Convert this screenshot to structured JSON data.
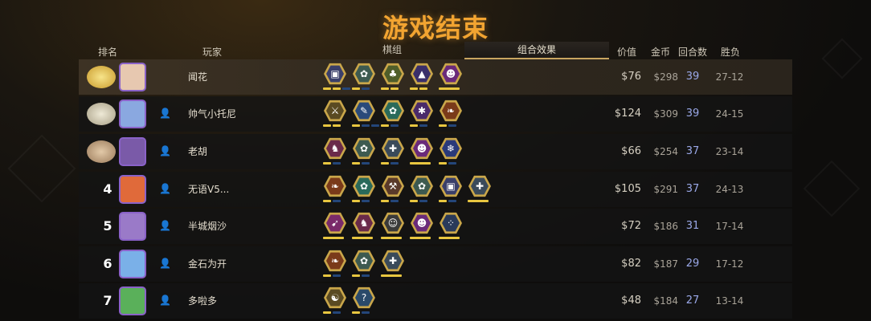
{
  "title": "游戏结束",
  "headers": {
    "rank": "排名",
    "player": "玩家",
    "board": "棋组",
    "combo": "组合效果",
    "price": "价值",
    "gold": "金币",
    "rounds": "回合数",
    "record": "胜负"
  },
  "players": [
    {
      "rank": "",
      "name": "闻花",
      "price": "$76",
      "gold": "$298",
      "rounds": "39",
      "record": "27-12",
      "medal": "gold",
      "avatar_color": "#e7c8b0",
      "synergies": [
        {
          "icon": "armor-icon",
          "color": "#3a3f6a",
          "symbol": "▣",
          "pips": [
            "#e8c640",
            "#e8c640",
            "#24467a"
          ]
        },
        {
          "icon": "beast-icon",
          "color": "#3d5a50",
          "symbol": "✿",
          "pips": [
            "#e8c640",
            "#24467a"
          ]
        },
        {
          "icon": "element-icon",
          "color": "#4f5e2a",
          "symbol": "♣",
          "pips": [
            "#e8c640",
            "#e8c640"
          ]
        },
        {
          "icon": "mage-icon",
          "color": "#3a2f6a",
          "symbol": "▲",
          "pips": [
            "#e8c640",
            "#e8c640"
          ]
        },
        {
          "icon": "demon-icon",
          "color": "#6a2a7a",
          "symbol": "☻",
          "pips": [
            "#e8c640"
          ]
        }
      ]
    },
    {
      "rank": "",
      "name": "帅气小托尼",
      "price": "$124",
      "gold": "$309",
      "rounds": "39",
      "record": "24-15",
      "medal": "silver",
      "avatar_color": "#8aa8e0",
      "synergies": [
        {
          "icon": "warrior-icon",
          "color": "#5a4a22",
          "symbol": "⚔",
          "pips": [
            "#e8c640",
            "#e8c640"
          ]
        },
        {
          "icon": "feather-icon",
          "color": "#2a4a7a",
          "symbol": "✎",
          "pips": [
            "#e8c640",
            "#24467a",
            "#24467a"
          ]
        },
        {
          "icon": "paw-icon",
          "color": "#2a6a5a",
          "symbol": "✿",
          "pips": [
            "#e8c640",
            "#24467a"
          ]
        },
        {
          "icon": "fish-icon",
          "color": "#4a2a6a",
          "symbol": "✱",
          "pips": [
            "#e8c640",
            "#24467a"
          ]
        },
        {
          "icon": "leaf-icon",
          "color": "#7a3a1a",
          "symbol": "❧",
          "pips": [
            "#e8c640",
            "#24467a"
          ]
        }
      ]
    },
    {
      "rank": "",
      "name": "老胡",
      "price": "$66",
      "gold": "$254",
      "rounds": "37",
      "record": "23-14",
      "medal": "bronze",
      "avatar_color": "#7a5aa8",
      "synergies": [
        {
          "icon": "knight-icon",
          "color": "#6a2a4a",
          "symbol": "♞",
          "pips": [
            "#e8c640",
            "#24467a"
          ]
        },
        {
          "icon": "beast-icon",
          "color": "#3d5a50",
          "symbol": "✿",
          "pips": [
            "#e8c640",
            "#24467a"
          ]
        },
        {
          "icon": "cross-icon",
          "color": "#3a4a5a",
          "symbol": "✚",
          "pips": [
            "#e8c640",
            "#24467a"
          ]
        },
        {
          "icon": "demon-icon",
          "color": "#6a2a7a",
          "symbol": "☻",
          "pips": [
            "#e8c640"
          ]
        },
        {
          "icon": "frost-icon",
          "color": "#2a3a7a",
          "symbol": "❄",
          "pips": [
            "#e8c640",
            "#24467a"
          ]
        }
      ]
    },
    {
      "rank": "4",
      "name": "无语V5...",
      "price": "$105",
      "gold": "$291",
      "rounds": "37",
      "record": "24-13",
      "medal": "",
      "avatar_color": "#e06a3a",
      "synergies": [
        {
          "icon": "leaf-icon",
          "color": "#7a3a1a",
          "symbol": "❧",
          "pips": [
            "#e8c640",
            "#24467a"
          ]
        },
        {
          "icon": "paw-icon",
          "color": "#2a6a5a",
          "symbol": "✿",
          "pips": [
            "#e8c640",
            "#24467a"
          ]
        },
        {
          "icon": "axe-icon",
          "color": "#5a3a2a",
          "symbol": "⚒",
          "pips": [
            "#e8c640",
            "#24467a"
          ]
        },
        {
          "icon": "beast-icon",
          "color": "#3d5a50",
          "symbol": "✿",
          "pips": [
            "#e8c640",
            "#24467a"
          ]
        },
        {
          "icon": "armor-icon",
          "color": "#3a3f6a",
          "symbol": "▣",
          "pips": [
            "#e8c640",
            "#24467a"
          ]
        },
        {
          "icon": "cross-icon",
          "color": "#3a4a5a",
          "symbol": "✚",
          "pips": [
            "#e8c640"
          ]
        }
      ]
    },
    {
      "rank": "5",
      "name": "半城烟沙",
      "price": "$72",
      "gold": "$186",
      "rounds": "31",
      "record": "17-14",
      "medal": "",
      "avatar_color": "#9a7ac8",
      "synergies": [
        {
          "icon": "hunter-icon",
          "color": "#7a2a6a",
          "symbol": "➹",
          "pips": [
            "#e8c640"
          ]
        },
        {
          "icon": "knight-icon",
          "color": "#6a2a4a",
          "symbol": "♞",
          "pips": [
            "#e8c640"
          ]
        },
        {
          "icon": "goblin-icon",
          "color": "#3a3a3a",
          "symbol": "☺",
          "pips": [
            "#e8c640"
          ]
        },
        {
          "icon": "demon-icon",
          "color": "#6a2a7a",
          "symbol": "☻",
          "pips": [
            "#e8c640"
          ]
        },
        {
          "icon": "dots-icon",
          "color": "#2a3a5a",
          "symbol": "⁘",
          "pips": [
            "#e8c640"
          ]
        }
      ]
    },
    {
      "rank": "6",
      "name": "金石为开",
      "price": "$82",
      "gold": "$187",
      "rounds": "29",
      "record": "17-12",
      "medal": "",
      "avatar_color": "#7ab0e8",
      "synergies": [
        {
          "icon": "leaf-icon",
          "color": "#7a3a1a",
          "symbol": "❧",
          "pips": [
            "#e8c640",
            "#24467a"
          ]
        },
        {
          "icon": "beast-icon",
          "color": "#3d5a50",
          "symbol": "✿",
          "pips": [
            "#e8c640",
            "#24467a"
          ]
        },
        {
          "icon": "cross-icon",
          "color": "#3a4a5a",
          "symbol": "✚",
          "pips": [
            "#e8c640"
          ]
        }
      ]
    },
    {
      "rank": "7",
      "name": "多啦多",
      "price": "$48",
      "gold": "$184",
      "rounds": "27",
      "record": "13-14",
      "medal": "",
      "avatar_color": "#5ab05a",
      "synergies": [
        {
          "icon": "yinyang-icon",
          "color": "#5a4a22",
          "symbol": "☯",
          "pips": [
            "#e8c640",
            "#24467a"
          ]
        },
        {
          "icon": "mystery-icon",
          "color": "#2a4a6a",
          "symbol": "?",
          "pips": [
            "#e8c640",
            "#24467a"
          ]
        }
      ]
    }
  ]
}
